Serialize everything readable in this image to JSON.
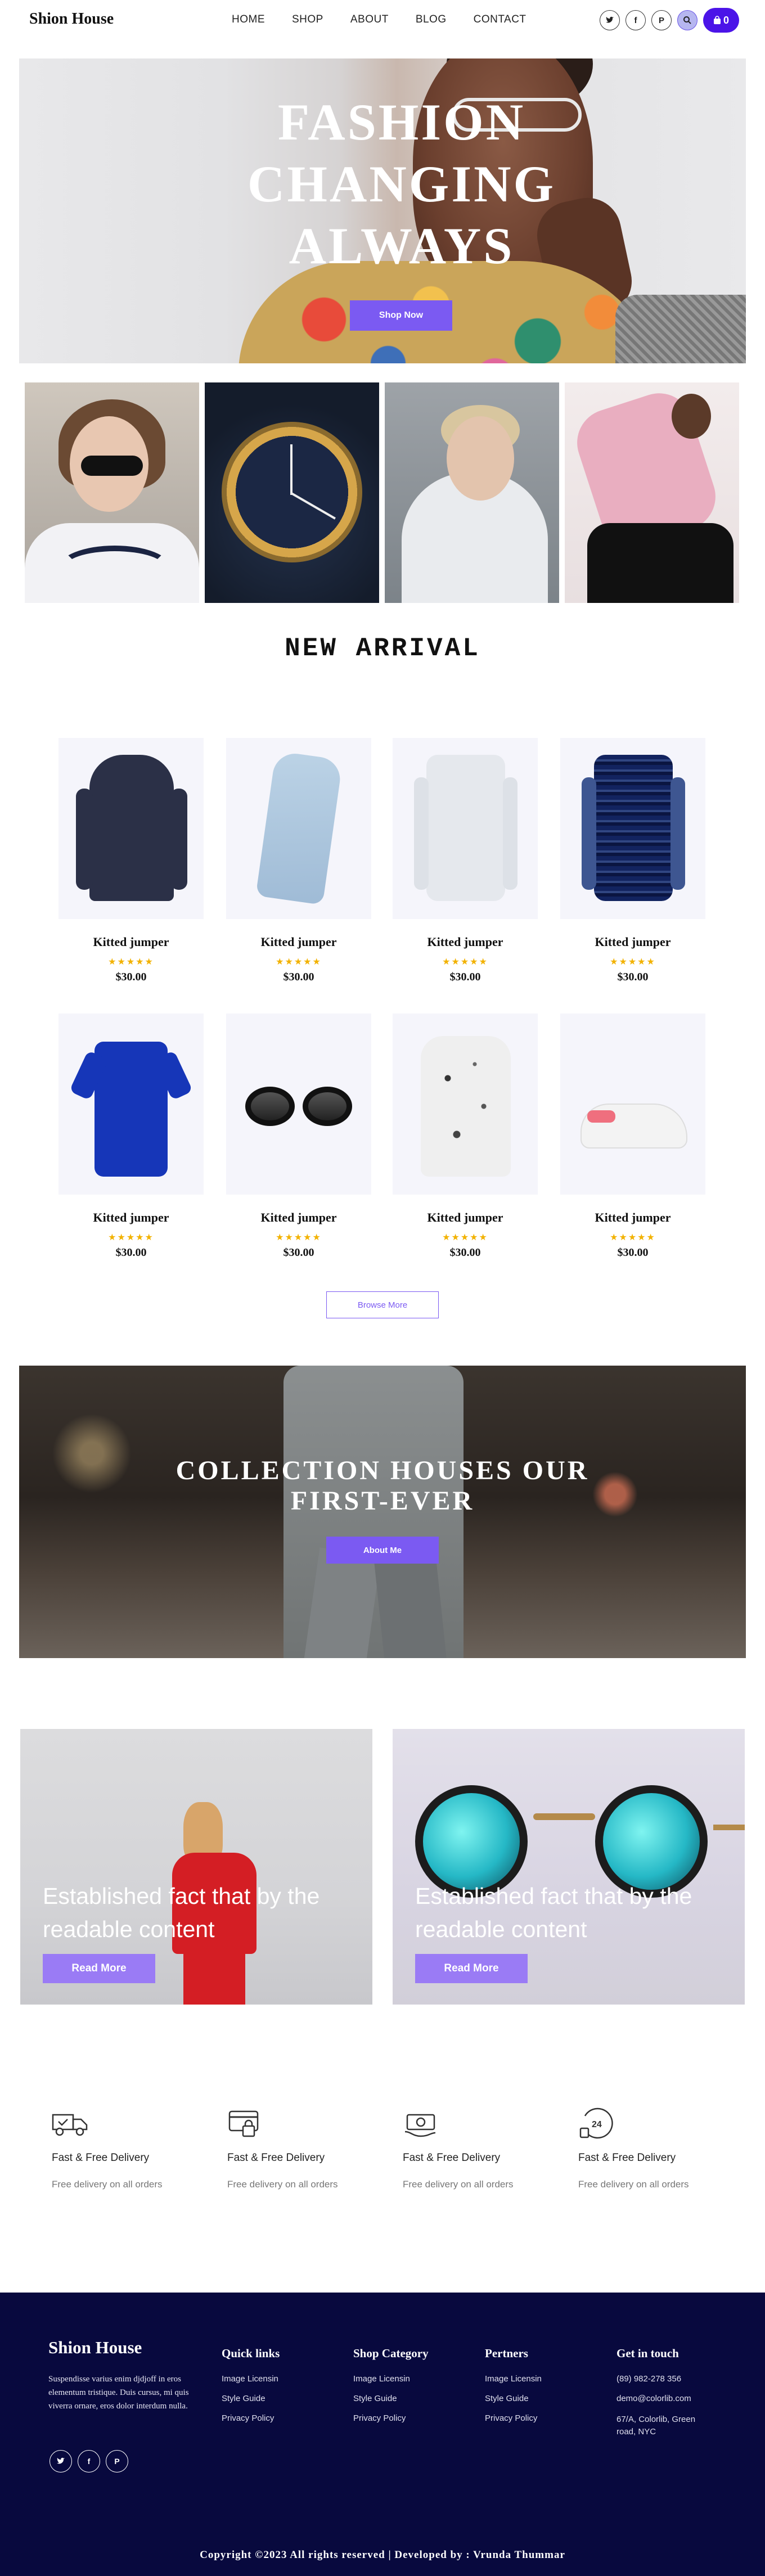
{
  "header": {
    "logo": "Shion House",
    "nav": [
      "HOME",
      "SHOP",
      "ABOUT",
      "BLOG",
      "CONTACT"
    ],
    "social_icons": [
      "twitter-icon",
      "facebook-icon",
      "pinterest-icon"
    ],
    "cart_count": "0"
  },
  "hero": {
    "title": "FASHION CHANGING ALWAYS",
    "button": "Shop Now"
  },
  "arrivals": {
    "title": "NEW ARRIVAL",
    "products": [
      {
        "name": "Kitted jumper",
        "stars": "★★★★★",
        "price": "$30.00",
        "icon": "hoodie"
      },
      {
        "name": "Kitted jumper",
        "stars": "★★★★★",
        "price": "$30.00",
        "icon": "scarf"
      },
      {
        "name": "Kitted jumper",
        "stars": "★★★★★",
        "price": "$30.00",
        "icon": "white-shirt"
      },
      {
        "name": "Kitted jumper",
        "stars": "★★★★★",
        "price": "$30.00",
        "icon": "plaid-shirt"
      },
      {
        "name": "Kitted jumper",
        "stars": "★★★★★",
        "price": "$30.00",
        "icon": "polo-shirt"
      },
      {
        "name": "Kitted jumper",
        "stars": "★★★★★",
        "price": "$30.00",
        "icon": "sunglasses"
      },
      {
        "name": "Kitted jumper",
        "stars": "★★★★★",
        "price": "$30.00",
        "icon": "sweater"
      },
      {
        "name": "Kitted jumper",
        "stars": "★★★★★",
        "price": "$30.00",
        "icon": "sneaker"
      }
    ],
    "browse_button": "Browse More"
  },
  "collection": {
    "title": "COLLECTION HOUSES OUR FIRST-EVER",
    "button": "About Me"
  },
  "promos": [
    {
      "text": "Established fact that by the readable content",
      "button": "Read More"
    },
    {
      "text": "Established fact that by the readable content",
      "button": "Read More"
    }
  ],
  "features": [
    {
      "title": "Fast & Free Delivery",
      "subtitle": "Free delivery on all orders",
      "icon": "truck-icon"
    },
    {
      "title": "Fast & Free Delivery",
      "subtitle": "Free delivery on all orders",
      "icon": "credit-card-icon"
    },
    {
      "title": "Fast & Free Delivery",
      "subtitle": "Free delivery on all orders",
      "icon": "cash-icon"
    },
    {
      "title": "Fast & Free Delivery",
      "subtitle": "Free delivery on all orders",
      "icon": "24-hours-icon"
    }
  ],
  "footer": {
    "logo": "Shion House",
    "description": "Suspendisse varius enim djdjoff in eros elementum tristique. Duis cursus, mi quis viverra ornare, eros dolor interdum nulla.",
    "quick_links": {
      "title": "Quick links",
      "items": [
        "Image Licensin",
        "Style Guide",
        "Privacy Policy"
      ]
    },
    "shop_category": {
      "title": "Shop Category",
      "items": [
        "Image Licensin",
        "Style Guide",
        "Privacy Policy"
      ]
    },
    "partners": {
      "title": "Pertners",
      "items": [
        "Image Licensin",
        "Style Guide",
        "Privacy Policy"
      ]
    },
    "contact": {
      "title": "Get in touch",
      "items": [
        "(89) 982-278 356",
        "demo@colorlib.com",
        "67/A, Colorlib, Green road, NYC"
      ]
    },
    "copyright": "Copyright ©2023 All rights reserved | Developed by : Vrunda Thummar"
  },
  "colors": {
    "accent": "#7b5af2",
    "cart": "#4b14e8",
    "footer_bg": "#08093e",
    "stars": "#f2b200"
  }
}
